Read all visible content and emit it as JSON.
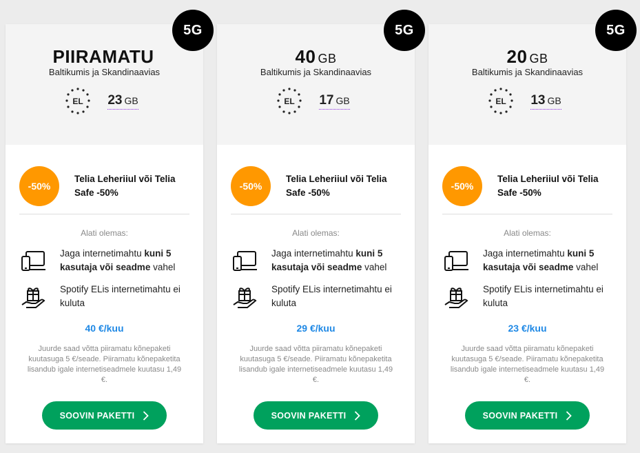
{
  "cards": [
    {
      "badge": "5G",
      "title": "PIIRAMATU",
      "unit": "",
      "subtitle": "Baltikumis ja Skandinaavias",
      "eu_label": "EL",
      "eu_amount": "23",
      "eu_unit": "GB",
      "discount": "-50%",
      "promo": "Telia Leheriiul või Telia Safe -50%",
      "always_label": "Alati olemas:",
      "feature1_pre": "Jaga internetimahtu ",
      "feature1_bold": "kuni 5 kasutaja või seadme",
      "feature1_post": " vahel",
      "feature2": "Spotify ELis internetimahtu ei kuluta",
      "price": "40 €/kuu",
      "note": "Juurde saad võtta piiramatu kõnepaketi kuutasuga 5 €/seade. Piiramatu kõnepaketita lisandub igale internetiseadmele kuutasu 1,49 €.",
      "button": "SOOVIN PAKETTI"
    },
    {
      "badge": "5G",
      "title": "40",
      "unit": "GB",
      "subtitle": "Baltikumis ja Skandinaavias",
      "eu_label": "EL",
      "eu_amount": "17",
      "eu_unit": "GB",
      "discount": "-50%",
      "promo": "Telia Leheriiul või Telia Safe -50%",
      "always_label": "Alati olemas:",
      "feature1_pre": "Jaga internetimahtu ",
      "feature1_bold": "kuni 5 kasutaja või seadme",
      "feature1_post": " vahel",
      "feature2": "Spotify ELis internetimahtu ei kuluta",
      "price": "29 €/kuu",
      "note": "Juurde saad võtta piiramatu kõnepaketi kuutasuga 5 €/seade. Piiramatu kõnepaketita lisandub igale internetiseadmele kuutasu 1,49 €.",
      "button": "SOOVIN PAKETTI"
    },
    {
      "badge": "5G",
      "title": "20",
      "unit": "GB",
      "subtitle": "Baltikumis ja Skandinaavias",
      "eu_label": "EL",
      "eu_amount": "13",
      "eu_unit": "GB",
      "discount": "-50%",
      "promo": "Telia Leheriiul või Telia Safe -50%",
      "always_label": "Alati olemas:",
      "feature1_pre": "Jaga internetimahtu ",
      "feature1_bold": "kuni 5 kasutaja või seadme",
      "feature1_post": " vahel",
      "feature2": "Spotify ELis internetimahtu ei kuluta",
      "price": "23 €/kuu",
      "note": "Juurde saad võtta piiramatu kõnepaketi kuutasuga 5 €/seade. Piiramatu kõnepaketita lisandub igale internetiseadmele kuutasu 1,49 €.",
      "button": "SOOVIN PAKETTI"
    }
  ],
  "colors": {
    "discount": "#ff9800",
    "price": "#1e88e5",
    "button": "#00a15d",
    "badge": "#000000"
  },
  "icons": {
    "eu": "eu-stars-icon",
    "feature1": "devices-icon",
    "feature2": "gift-hand-icon",
    "button": "chevron-right-icon"
  }
}
